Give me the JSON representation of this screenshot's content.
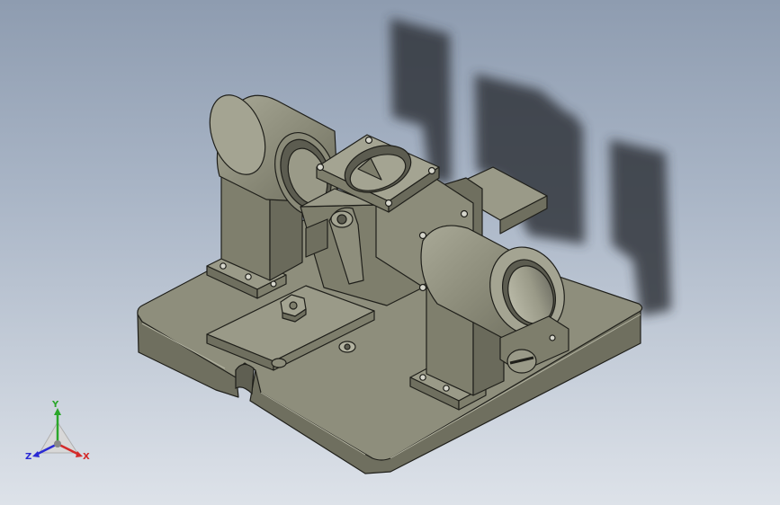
{
  "viewport": {
    "background_top": "#8e9cb0",
    "background_bottom": "#dde2e9",
    "model_color": "#8e8e7c",
    "model_shade": "#6f6f5f",
    "model_highlight": "#b3b3a1",
    "shadow_color": "#2f3338"
  },
  "triad": {
    "x_label": "X",
    "y_label": "Y",
    "z_label": "Z",
    "x_color": "#d42a2a",
    "y_color": "#2aa62a",
    "z_color": "#2a2ad4"
  }
}
